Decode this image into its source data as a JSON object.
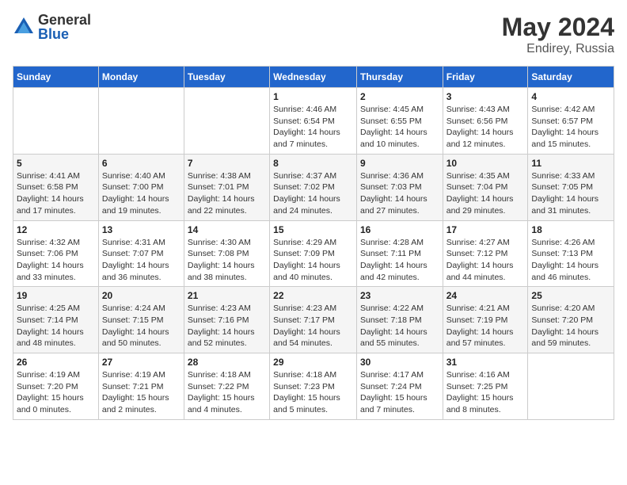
{
  "logo": {
    "general": "General",
    "blue": "Blue"
  },
  "title": {
    "month_year": "May 2024",
    "location": "Endirey, Russia"
  },
  "days_of_week": [
    "Sunday",
    "Monday",
    "Tuesday",
    "Wednesday",
    "Thursday",
    "Friday",
    "Saturday"
  ],
  "weeks": [
    [
      {
        "num": "",
        "info": ""
      },
      {
        "num": "",
        "info": ""
      },
      {
        "num": "",
        "info": ""
      },
      {
        "num": "1",
        "info": "Sunrise: 4:46 AM\nSunset: 6:54 PM\nDaylight: 14 hours\nand 7 minutes."
      },
      {
        "num": "2",
        "info": "Sunrise: 4:45 AM\nSunset: 6:55 PM\nDaylight: 14 hours\nand 10 minutes."
      },
      {
        "num": "3",
        "info": "Sunrise: 4:43 AM\nSunset: 6:56 PM\nDaylight: 14 hours\nand 12 minutes."
      },
      {
        "num": "4",
        "info": "Sunrise: 4:42 AM\nSunset: 6:57 PM\nDaylight: 14 hours\nand 15 minutes."
      }
    ],
    [
      {
        "num": "5",
        "info": "Sunrise: 4:41 AM\nSunset: 6:58 PM\nDaylight: 14 hours\nand 17 minutes."
      },
      {
        "num": "6",
        "info": "Sunrise: 4:40 AM\nSunset: 7:00 PM\nDaylight: 14 hours\nand 19 minutes."
      },
      {
        "num": "7",
        "info": "Sunrise: 4:38 AM\nSunset: 7:01 PM\nDaylight: 14 hours\nand 22 minutes."
      },
      {
        "num": "8",
        "info": "Sunrise: 4:37 AM\nSunset: 7:02 PM\nDaylight: 14 hours\nand 24 minutes."
      },
      {
        "num": "9",
        "info": "Sunrise: 4:36 AM\nSunset: 7:03 PM\nDaylight: 14 hours\nand 27 minutes."
      },
      {
        "num": "10",
        "info": "Sunrise: 4:35 AM\nSunset: 7:04 PM\nDaylight: 14 hours\nand 29 minutes."
      },
      {
        "num": "11",
        "info": "Sunrise: 4:33 AM\nSunset: 7:05 PM\nDaylight: 14 hours\nand 31 minutes."
      }
    ],
    [
      {
        "num": "12",
        "info": "Sunrise: 4:32 AM\nSunset: 7:06 PM\nDaylight: 14 hours\nand 33 minutes."
      },
      {
        "num": "13",
        "info": "Sunrise: 4:31 AM\nSunset: 7:07 PM\nDaylight: 14 hours\nand 36 minutes."
      },
      {
        "num": "14",
        "info": "Sunrise: 4:30 AM\nSunset: 7:08 PM\nDaylight: 14 hours\nand 38 minutes."
      },
      {
        "num": "15",
        "info": "Sunrise: 4:29 AM\nSunset: 7:09 PM\nDaylight: 14 hours\nand 40 minutes."
      },
      {
        "num": "16",
        "info": "Sunrise: 4:28 AM\nSunset: 7:11 PM\nDaylight: 14 hours\nand 42 minutes."
      },
      {
        "num": "17",
        "info": "Sunrise: 4:27 AM\nSunset: 7:12 PM\nDaylight: 14 hours\nand 44 minutes."
      },
      {
        "num": "18",
        "info": "Sunrise: 4:26 AM\nSunset: 7:13 PM\nDaylight: 14 hours\nand 46 minutes."
      }
    ],
    [
      {
        "num": "19",
        "info": "Sunrise: 4:25 AM\nSunset: 7:14 PM\nDaylight: 14 hours\nand 48 minutes."
      },
      {
        "num": "20",
        "info": "Sunrise: 4:24 AM\nSunset: 7:15 PM\nDaylight: 14 hours\nand 50 minutes."
      },
      {
        "num": "21",
        "info": "Sunrise: 4:23 AM\nSunset: 7:16 PM\nDaylight: 14 hours\nand 52 minutes."
      },
      {
        "num": "22",
        "info": "Sunrise: 4:23 AM\nSunset: 7:17 PM\nDaylight: 14 hours\nand 54 minutes."
      },
      {
        "num": "23",
        "info": "Sunrise: 4:22 AM\nSunset: 7:18 PM\nDaylight: 14 hours\nand 55 minutes."
      },
      {
        "num": "24",
        "info": "Sunrise: 4:21 AM\nSunset: 7:19 PM\nDaylight: 14 hours\nand 57 minutes."
      },
      {
        "num": "25",
        "info": "Sunrise: 4:20 AM\nSunset: 7:20 PM\nDaylight: 14 hours\nand 59 minutes."
      }
    ],
    [
      {
        "num": "26",
        "info": "Sunrise: 4:19 AM\nSunset: 7:20 PM\nDaylight: 15 hours\nand 0 minutes."
      },
      {
        "num": "27",
        "info": "Sunrise: 4:19 AM\nSunset: 7:21 PM\nDaylight: 15 hours\nand 2 minutes."
      },
      {
        "num": "28",
        "info": "Sunrise: 4:18 AM\nSunset: 7:22 PM\nDaylight: 15 hours\nand 4 minutes."
      },
      {
        "num": "29",
        "info": "Sunrise: 4:18 AM\nSunset: 7:23 PM\nDaylight: 15 hours\nand 5 minutes."
      },
      {
        "num": "30",
        "info": "Sunrise: 4:17 AM\nSunset: 7:24 PM\nDaylight: 15 hours\nand 7 minutes."
      },
      {
        "num": "31",
        "info": "Sunrise: 4:16 AM\nSunset: 7:25 PM\nDaylight: 15 hours\nand 8 minutes."
      },
      {
        "num": "",
        "info": ""
      }
    ]
  ]
}
